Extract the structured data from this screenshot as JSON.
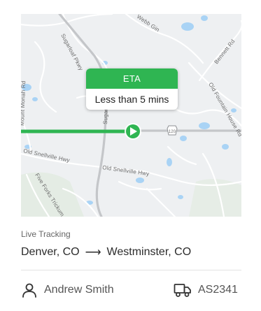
{
  "map": {
    "road_labels": [
      "Sugarloaf Pkwy",
      "Webb Gin",
      "Bennett Rd",
      "Old Fountain House Rd",
      "Mount Moriah Rd",
      "Old Snellville Hwy",
      "Old Snellville Hwy",
      "Five Forks Trickum Rd",
      "Sugarloaf Pkwy",
      "120"
    ],
    "colors": {
      "route": "#2fb552",
      "road": "#c9cacc",
      "water": "#a9d3f5",
      "park": "#dceedd"
    }
  },
  "eta": {
    "title": "ETA",
    "value": "Less than 5 mins"
  },
  "tracking": {
    "label": "Live Tracking",
    "origin": "Denver, CO",
    "arrow": "⟶",
    "destination": "Westminster, CO"
  },
  "driver": {
    "name": "Andrew Smith",
    "icon": "user-icon"
  },
  "vehicle": {
    "id": "AS2341",
    "icon": "truck-icon"
  }
}
